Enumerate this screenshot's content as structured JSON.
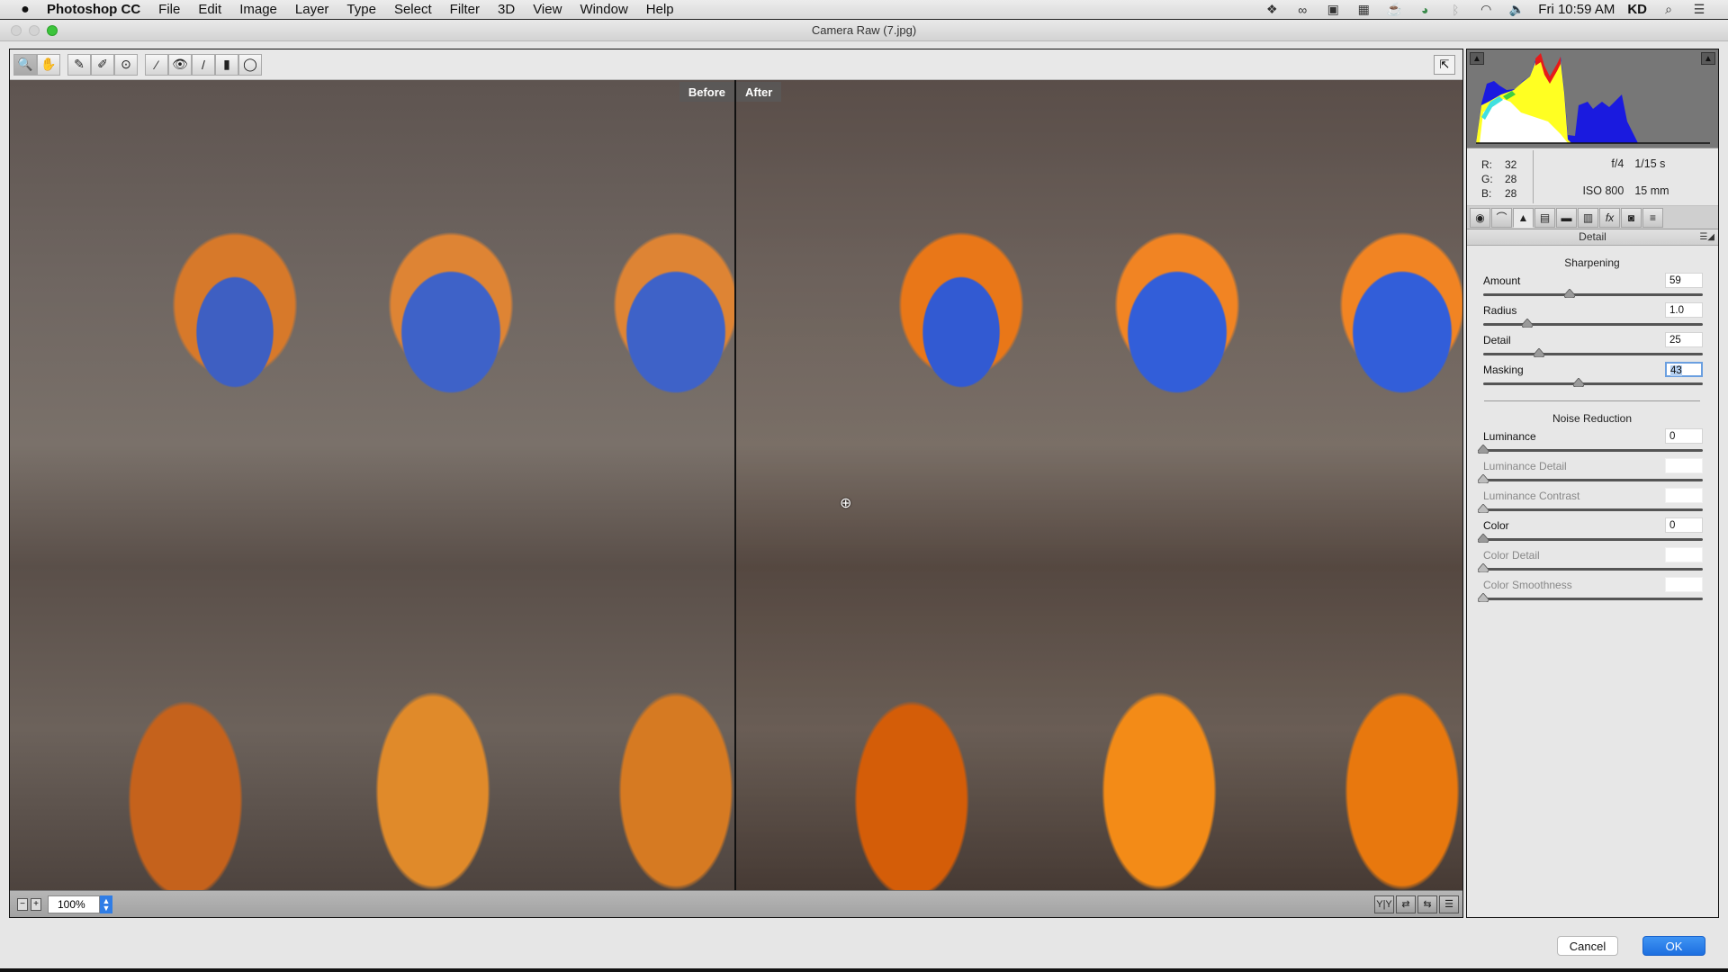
{
  "menubar": {
    "app_name": "Photoshop CC",
    "items": [
      "File",
      "Edit",
      "Image",
      "Layer",
      "Type",
      "Select",
      "Filter",
      "3D",
      "View",
      "Window",
      "Help"
    ],
    "status_icons": [
      "dropbox-icon",
      "creative-cloud-icon",
      "screen-record-icon",
      "display-icon",
      "caffeine-icon",
      "sync-icon",
      "bluetooth-icon",
      "wifi-icon",
      "volume-icon"
    ],
    "clock": "Fri 10:59 AM",
    "user": "KD"
  },
  "window": {
    "title": "Camera Raw (7.jpg)"
  },
  "toolbar": {
    "tools": [
      {
        "name": "zoom-tool",
        "glyph": "🔍",
        "active": true
      },
      {
        "name": "hand-tool",
        "glyph": "✋",
        "active": false
      },
      {
        "name": "white-balance-tool",
        "glyph": "✎",
        "active": false
      },
      {
        "name": "color-sampler-tool",
        "glyph": "✐",
        "active": false
      },
      {
        "name": "targeted-adjustment-tool",
        "glyph": "⊙",
        "active": false
      },
      {
        "name": "spot-removal-tool",
        "glyph": "⁄",
        "active": false
      },
      {
        "name": "red-eye-tool",
        "glyph": "👁",
        "active": false
      },
      {
        "name": "adjustment-brush-tool",
        "glyph": "/",
        "active": false
      },
      {
        "name": "graduated-filter-tool",
        "glyph": "▮",
        "active": false
      },
      {
        "name": "radial-filter-tool",
        "glyph": "◯",
        "active": false
      }
    ],
    "fullscreen_glyph": "⇱"
  },
  "preview": {
    "before_label": "Before",
    "after_label": "After"
  },
  "statusbar": {
    "zoom_out_glyph": "−",
    "zoom_in_glyph": "+",
    "zoom_level": "100%",
    "view_buttons": [
      "Y|Y",
      "⇄",
      "⇆",
      "☰"
    ]
  },
  "histogram": {
    "rgb": {
      "r_label": "R:",
      "r": "32",
      "g_label": "G:",
      "g": "28",
      "b_label": "B:",
      "b": "28"
    },
    "exif": {
      "aperture": "f/4",
      "shutter": "1/15 s",
      "iso": "ISO 800",
      "focal_length": "15 mm"
    }
  },
  "panel_tabs": [
    {
      "name": "basic-tab",
      "glyph": "◉"
    },
    {
      "name": "tone-curve-tab",
      "glyph": "⌒"
    },
    {
      "name": "detail-tab",
      "glyph": "▲",
      "active": true
    },
    {
      "name": "hsl-tab",
      "glyph": "▤"
    },
    {
      "name": "split-toning-tab",
      "glyph": "▬"
    },
    {
      "name": "lens-corrections-tab",
      "glyph": "▥"
    },
    {
      "name": "effects-tab",
      "glyph": "fx"
    },
    {
      "name": "camera-calibration-tab",
      "glyph": "◙"
    },
    {
      "name": "presets-tab",
      "glyph": "≡"
    }
  ],
  "detail": {
    "section_title": "Detail",
    "sharpening": {
      "title": "Sharpening",
      "sliders": [
        {
          "label": "Amount",
          "value": "59",
          "fraction": 0.39,
          "enabled": true,
          "selected": false
        },
        {
          "label": "Radius",
          "value": "1.0",
          "fraction": 0.2,
          "enabled": true,
          "selected": false
        },
        {
          "label": "Detail",
          "value": "25",
          "fraction": 0.25,
          "enabled": true,
          "selected": false
        },
        {
          "label": "Masking",
          "value": "43",
          "fraction": 0.43,
          "enabled": true,
          "selected": true
        }
      ]
    },
    "noise_reduction": {
      "title": "Noise Reduction",
      "sliders": [
        {
          "label": "Luminance",
          "value": "0",
          "fraction": 0,
          "enabled": true
        },
        {
          "label": "Luminance Detail",
          "value": "",
          "fraction": 0,
          "enabled": false
        },
        {
          "label": "Luminance Contrast",
          "value": "",
          "fraction": 0,
          "enabled": false
        },
        {
          "label": "Color",
          "value": "0",
          "fraction": 0,
          "enabled": true
        },
        {
          "label": "Color Detail",
          "value": "",
          "fraction": 0,
          "enabled": false
        },
        {
          "label": "Color Smoothness",
          "value": "",
          "fraction": 0,
          "enabled": false
        }
      ]
    }
  },
  "footer": {
    "cancel_label": "Cancel",
    "ok_label": "OK"
  },
  "colors": {
    "accent_blue": "#1d6fe0",
    "selection_blue": "#b4cff0",
    "traffic_green": "#3cc43b"
  }
}
